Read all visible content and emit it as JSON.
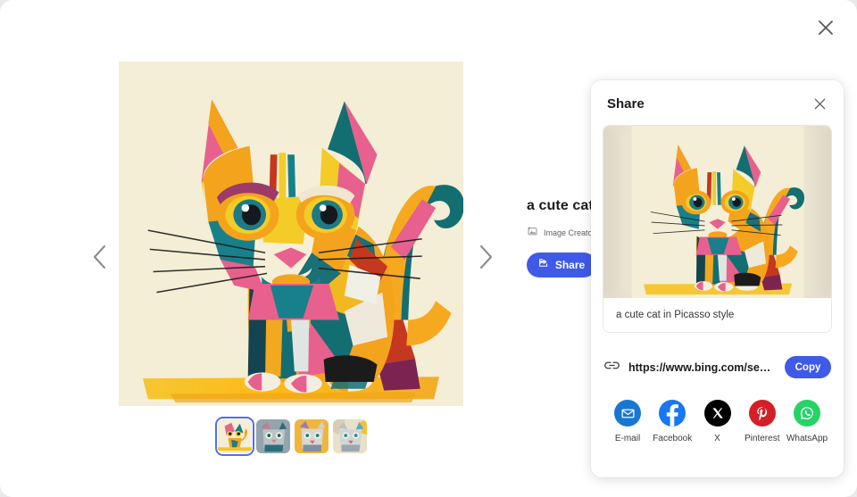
{
  "window": {
    "close_icon": "close-icon"
  },
  "viewer": {
    "prev_icon": "chevron-left-icon",
    "next_icon": "chevron-right-icon",
    "main_image_alt": "a cute cat in Picasso style",
    "thumbnails": [
      {
        "label": "thumbnail-1",
        "selected": true
      },
      {
        "label": "thumbnail-2",
        "selected": false
      },
      {
        "label": "thumbnail-3",
        "selected": false
      },
      {
        "label": "thumbnail-4",
        "selected": false
      }
    ]
  },
  "detail": {
    "title": "a cute cat i",
    "creator_icon": "image-creator-icon",
    "creator_label": "Image Creator in",
    "share_icon": "share-icon",
    "share_label": "Share"
  },
  "share_panel": {
    "title": "Share",
    "close_icon": "close-icon",
    "preview_caption": "a cute cat in Picasso style",
    "link_icon": "link-icon",
    "url": "https://www.bing.com/searc...",
    "copy_label": "Copy",
    "socials": [
      {
        "name": "E-mail",
        "icon": "email-icon",
        "color": "#1877d2"
      },
      {
        "name": "Facebook",
        "icon": "facebook-icon",
        "color": "#1877f2"
      },
      {
        "name": "X",
        "icon": "x-icon",
        "color": "#000000"
      },
      {
        "name": "Pinterest",
        "icon": "pinterest-icon",
        "color": "#d32027"
      },
      {
        "name": "WhatsApp",
        "icon": "whatsapp-icon",
        "color": "#25d366"
      }
    ]
  },
  "colors": {
    "accent_blue": "#3f5ae8",
    "selected_thumb_border": "#4f6ef0",
    "canvas_cream": "#f3eed5"
  }
}
